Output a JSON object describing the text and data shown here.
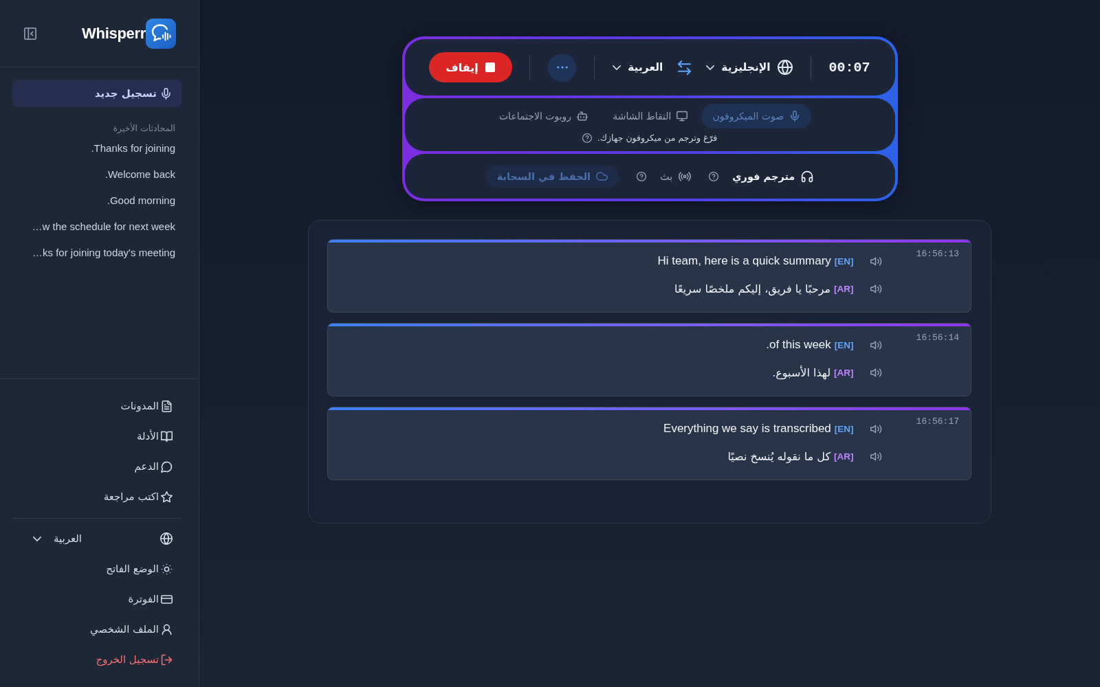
{
  "sidebar": {
    "logo": "Whisperr",
    "new_recording": {
      "label": "تسجيل جديد",
      "selected": true
    },
    "recent_heading": "المحادثات الأخيرة",
    "recent": [
      ".Thanks for joining",
      ".Welcome back",
      ".Good morning",
      "…w the schedule for next week",
      "…ks for joining today's meeting"
    ],
    "links": [
      "المدونات",
      "الأدلة",
      "الدعم",
      "اكتب مراجعة"
    ],
    "language": "العربية",
    "account": [
      {
        "label": "الوضع الفاتح",
        "kind": "normal"
      },
      {
        "label": "الفوترة",
        "kind": "normal"
      },
      {
        "label": "الملف الشخصي",
        "kind": "normal"
      },
      {
        "label": "تسجيل الخروج",
        "kind": "danger"
      }
    ]
  },
  "recorder": {
    "timer": "00:07",
    "source_language": "الإنجليزية",
    "target_language": "العربية",
    "stop_button": "إيقاف"
  },
  "input_sources": {
    "tabs": [
      {
        "label": "صوت الميكروفون",
        "selected": true
      },
      {
        "label": "التقاط الشاشة",
        "selected": false
      },
      {
        "label": "روبوت الاجتماعات",
        "selected": false
      }
    ],
    "hint": "فرّغ وترجم من ميكروفون جهازك."
  },
  "options": [
    {
      "kind": "feature",
      "label": "مترجم فوري",
      "on": true
    },
    {
      "kind": "feature",
      "label": "بث",
      "on": false
    },
    {
      "kind": "pill",
      "label": "الحفظ في السحابة",
      "on": true
    }
  ],
  "transcript": [
    {
      "time": "16:56:13",
      "lines": [
        {
          "kind": "source",
          "tag": "[EN]",
          "text": "Hi team, here is a quick summary"
        },
        {
          "kind": "translation",
          "tag": "[AR]",
          "text": "مرحبًا يا فريق، إليكم ملخصًا سريعًا"
        }
      ]
    },
    {
      "time": "16:56:14",
      "lines": [
        {
          "kind": "source",
          "tag": "[EN]",
          "text": ".of this week"
        },
        {
          "kind": "translation",
          "tag": "[AR]",
          "text": "لهذا الأسبوع."
        }
      ]
    },
    {
      "time": "16:56:17",
      "lines": [
        {
          "kind": "source",
          "tag": "[EN]",
          "text": "Everything we say is transcribed"
        },
        {
          "kind": "translation",
          "tag": "[AR]",
          "text": "كل ما نقوله يُنسخ نصيًا"
        }
      ]
    }
  ]
}
